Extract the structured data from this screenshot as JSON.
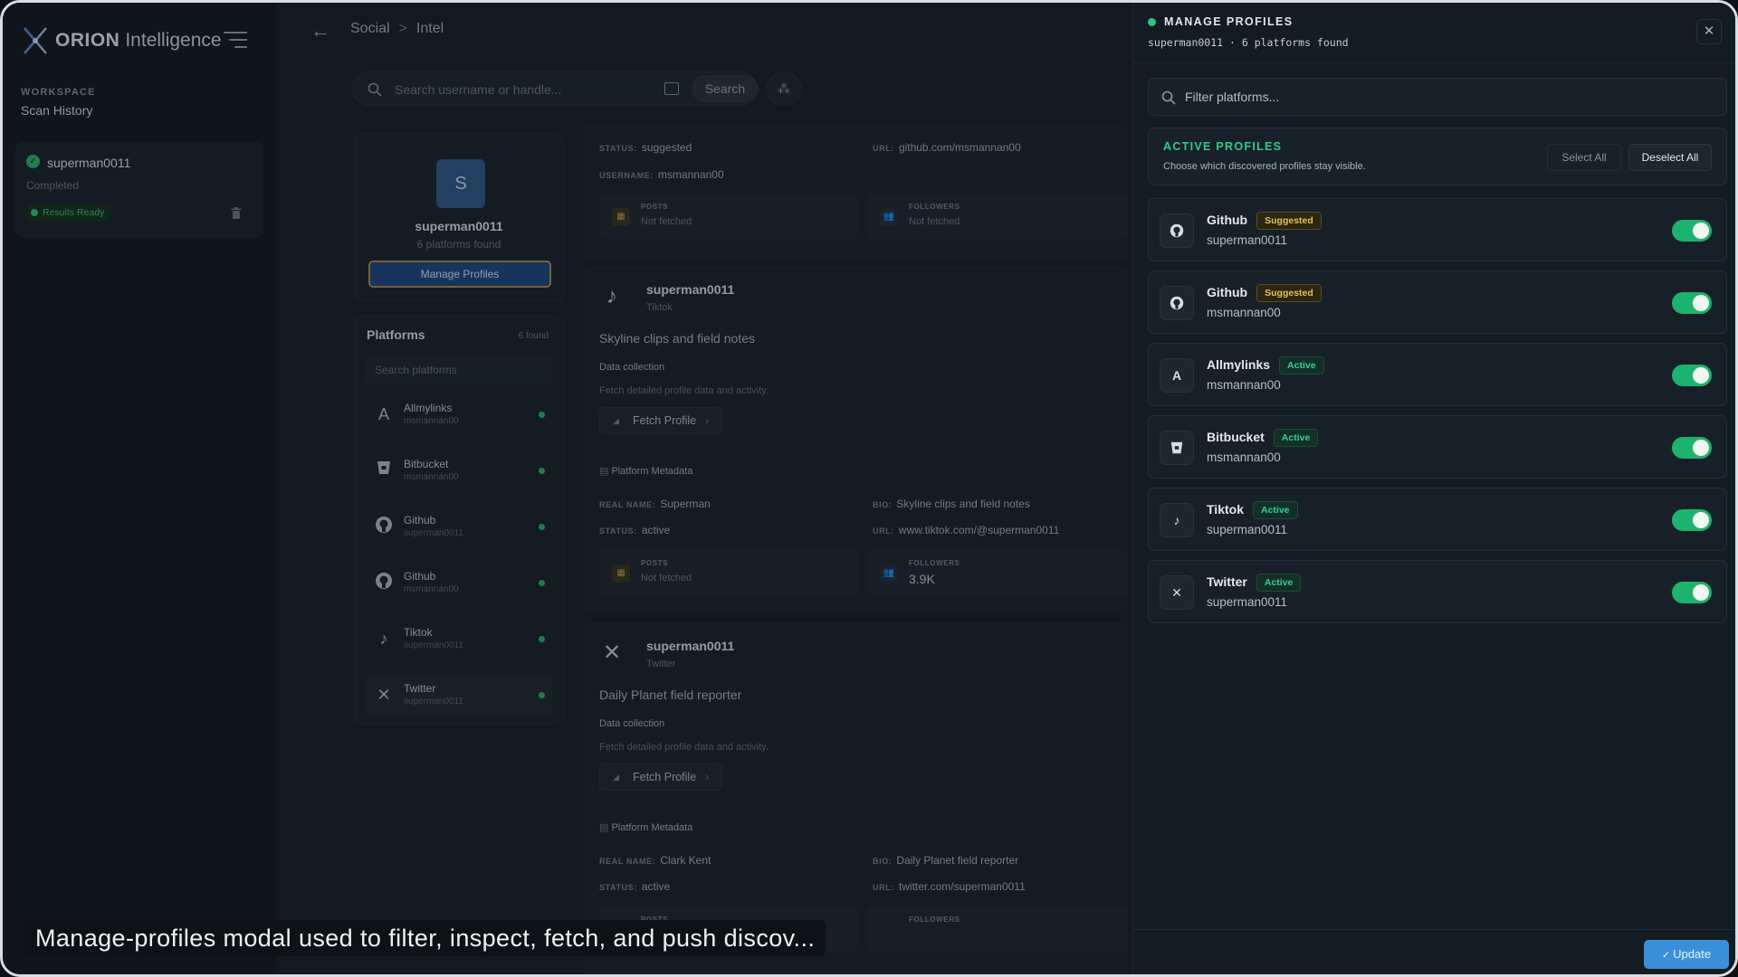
{
  "app": {
    "logo_bold": "ORION",
    "logo_rest": "Intelligence"
  },
  "sidebar": {
    "workspace_label": "WORKSPACE",
    "workspace_title": "Scan History",
    "scan": {
      "name": "superman0011",
      "status": "Completed",
      "badge": "Results Ready"
    }
  },
  "header": {
    "crumb1": "Social",
    "crumb2": "Intel",
    "crumb_sep": ">",
    "search_placeholder": "Search username or handle...",
    "search_button": "Search"
  },
  "profile": {
    "initial": "S",
    "name": "superman0011",
    "found": "6 platforms found",
    "manage": "Manage Profiles"
  },
  "platforms": {
    "title": "Platforms",
    "count": "6 found",
    "search_placeholder": "Search platforms",
    "items": [
      {
        "name": "Allmylinks",
        "user": "msmannan00",
        "icon": "A"
      },
      {
        "name": "Bitbucket",
        "user": "msmannan00",
        "icon": "bitbucket"
      },
      {
        "name": "Github",
        "user": "superman0011",
        "icon": "github"
      },
      {
        "name": "Github",
        "user": "msmannan00",
        "icon": "github"
      },
      {
        "name": "Tiktok",
        "user": "superman0011",
        "icon": "tiktok"
      },
      {
        "name": "Twitter",
        "user": "superman0011",
        "icon": "x"
      }
    ]
  },
  "results": {
    "r0": {
      "status_k": "STATUS:",
      "status": "suggested",
      "url_k": "URL:",
      "url": "github.com/msmannan00",
      "username_k": "USERNAME:",
      "username": "msmannan00",
      "posts_k": "POSTS",
      "posts": "Not fetched",
      "followers_k": "FOLLOWERS",
      "followers": "Not fetched"
    },
    "r1": {
      "name": "superman0011",
      "platform": "Tiktok",
      "bio": "Skyline clips and field notes",
      "dc": "Data collection",
      "dcs": "Fetch detailed profile data and activity.",
      "fetch": "Fetch Profile",
      "pm": "Platform Metadata",
      "real_k": "REAL NAME:",
      "real": "Superman",
      "bio_k": "BIO:",
      "bio2": "Skyline clips and field notes",
      "status_k": "STATUS:",
      "status": "active",
      "url_k": "URL:",
      "url": "www.tiktok.com/@superman0011",
      "posts_k": "POSTS",
      "posts": "Not fetched",
      "followers_k": "FOLLOWERS",
      "followers": "3.9K"
    },
    "r2": {
      "name": "superman0011",
      "platform": "Twitter",
      "bio": "Daily Planet field reporter",
      "dc": "Data collection",
      "dcs": "Fetch detailed profile data and activity.",
      "fetch": "Fetch Profile",
      "pm": "Platform Metadata",
      "real_k": "REAL NAME:",
      "real": "Clark Kent",
      "bio_k": "BIO:",
      "bio2": "Daily Planet field reporter",
      "status_k": "STATUS:",
      "status": "active",
      "url_k": "URL:",
      "url": "twitter.com/superman0011",
      "posts_k": "POSTS",
      "followers_k": "FOLLOWERS"
    }
  },
  "drawer": {
    "title": "MANAGE PROFILES",
    "subtitle": "superman0011 · 6 platforms found",
    "filter_placeholder": "Filter platforms...",
    "active_title": "ACTIVE PROFILES",
    "active_desc": "Choose which discovered profiles stay visible.",
    "select_all": "Select All",
    "deselect_all": "Deselect All",
    "cards": [
      {
        "name": "Github",
        "badge": "Suggested",
        "user": "superman0011",
        "icon": "github"
      },
      {
        "name": "Github",
        "badge": "Suggested",
        "user": "msmannan00",
        "icon": "github"
      },
      {
        "name": "Allmylinks",
        "badge": "Active",
        "user": "msmannan00",
        "icon": "A"
      },
      {
        "name": "Bitbucket",
        "badge": "Active",
        "user": "msmannan00",
        "icon": "bitbucket"
      },
      {
        "name": "Tiktok",
        "badge": "Active",
        "user": "superman0011",
        "icon": "tiktok"
      },
      {
        "name": "Twitter",
        "badge": "Active",
        "user": "superman0011",
        "icon": "x"
      }
    ],
    "update": "Update"
  },
  "caption": "Manage-profiles modal used to filter, inspect, fetch, and push discov...",
  "colors": {
    "accent": "#35c98b",
    "primary": "#3a8fd9",
    "toggle_on": "#1eb36c",
    "suggested": "#e2c15a"
  }
}
